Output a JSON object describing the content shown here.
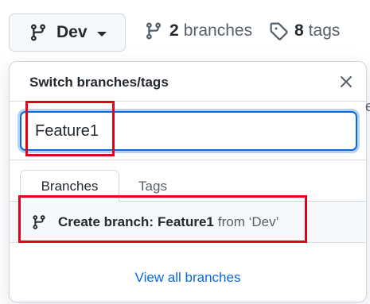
{
  "branch_selector": {
    "current_branch": "Dev",
    "icon": "git-branch-icon",
    "caret_icon": "triangle-down-icon"
  },
  "repo_meta": {
    "branches_count": "2",
    "branches_label": "branches",
    "branches_icon": "git-branch-icon",
    "tags_count": "8",
    "tags_label": "tags",
    "tags_icon": "tag-icon"
  },
  "dropdown": {
    "title": "Switch branches/tags",
    "close_icon": "close-icon",
    "filter_value": "Feature1",
    "tabs": [
      {
        "label": "Branches",
        "selected": true
      },
      {
        "label": "Tags",
        "selected": false
      }
    ],
    "create_branch": {
      "prefix": "Create branch:",
      "branch_name": "Feature1",
      "from_text": "from ‘Dev’",
      "icon": "git-branch-icon"
    },
    "view_all_label": "View all branches"
  },
  "annotations": {
    "highlight_color": "#e3001b"
  },
  "colors": {
    "accent": "#0969da",
    "muted_text": "#57606a",
    "text": "#24292f",
    "border": "#d0d7de"
  }
}
